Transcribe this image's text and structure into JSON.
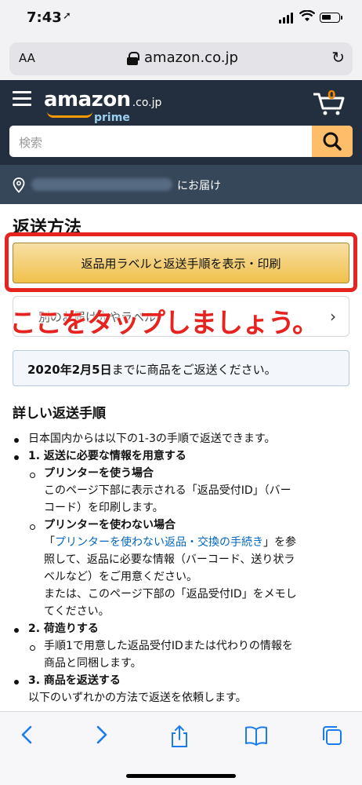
{
  "status_bar": {
    "time": "7:43",
    "location_icon": "location-arrow-icon"
  },
  "browser": {
    "text_size_label": "AA",
    "url": "amazon.co.jp",
    "lock_icon": "lock-icon",
    "reload_icon": "reload-icon"
  },
  "amazon": {
    "logo_word": "amazon",
    "logo_tld": ".co.jp",
    "logo_prime": "prime",
    "cart_count": "0",
    "search_placeholder": "検索",
    "deliver_to": "にお届け"
  },
  "page": {
    "title": "返送方法",
    "primary_button": "返品用ラベルと返送手順を表示・印刷",
    "secondary_button": "別のお届け先やラベル",
    "annotation": "ここをタップしましょう。",
    "notice_date": "2020年2月5日",
    "notice_suffix": "までに商品をご返送ください。",
    "steps_heading": "詳しい返送手順",
    "steps": {
      "intro": "日本国内からは以下の1-3の手順で返送できます。",
      "s1": "1. 返送に必要な情報を用意する",
      "s1a_title": "プリンターを使う場合",
      "s1a_line1": "このページ下部に表示される「返品受付ID」（バー",
      "s1a_line2": "コード）を印刷します。",
      "s1b_title": "プリンターを使わない場合",
      "s1b_quote_open": "「",
      "s1b_link": "プリンターを使わない返品・交換の手続き",
      "s1b_quote_close": "」を参",
      "s1b_line2": "照して、返品に必要な情報（バーコード、送り状ラ",
      "s1b_line3": "ベルなど）をご用意ください。",
      "s1b_line4": "または、このページ下部の「返品受付ID」をメモし",
      "s1b_line5": "てください。",
      "s2": "2. 荷造りする",
      "s2a_line1": "手順1で用意した返品受付IDまたは代わりの情報を",
      "s2a_line2": "商品と同梱します。",
      "s3": "3. 商品を返送する",
      "s3_line1": "以下のいずれかの方法で返送を依頼します。"
    }
  },
  "colors": {
    "amazon_dark": "#232f3e",
    "amazon_deliver": "#37475a",
    "button_yellow": "#f0c14b",
    "annotation_red": "#e6231f",
    "link_blue": "#0066c0",
    "safari_blue": "#1b7cf0"
  }
}
